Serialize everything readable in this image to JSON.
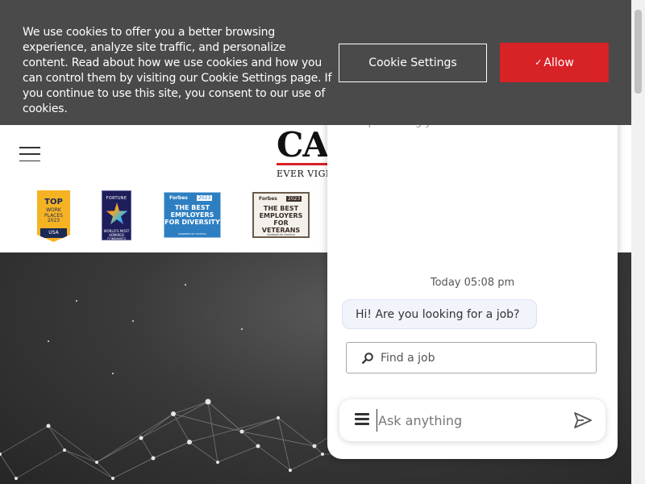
{
  "cookie_banner": {
    "text": "We use cookies to offer you a better browsing experience, analyze site traffic, and personalize content. Read about how we use cookies and how you can control them by visiting our Cookie Settings page. If you continue to use this site, you consent to our use of cookies.",
    "settings_label": "Cookie Settings",
    "allow_check": "✓",
    "allow_label": "Allow"
  },
  "header": {
    "logo_text": "CACI",
    "logo_tagline": "EVER VIGILANT",
    "badges": {
      "top_workplaces": {
        "line1": "TOP",
        "line2": "WORK PLACES",
        "year": "2023",
        "country": "USA"
      },
      "fortune": {
        "title": "FORTUNE",
        "line": "WORLD'S MOST ADMIRED COMPANIES"
      },
      "forbes_diversity": {
        "brand": "Forbes",
        "year": "2023",
        "line1": "THE BEST",
        "line2": "EMPLOYERS",
        "line3": "FOR DIVERSITY",
        "small": "POWERED BY STATISTA"
      },
      "forbes_veterans": {
        "brand": "Forbes",
        "year": "2023",
        "line1": "THE BEST",
        "line2": "EMPLOYERS",
        "line3": "FOR VETERANS",
        "small": "POWERED BY STATISTA"
      }
    }
  },
  "chat": {
    "faded_text": "and protecting your data",
    "timestamp": "Today 05:08 pm",
    "bot_message": "Hi! Are you looking for a job?",
    "find_job_label": "Find a job",
    "input_placeholder": "Ask anything"
  },
  "colors": {
    "banner_bg": "#4a4a4a",
    "allow_button": "#d72226",
    "hero_bg": "#3a3a3a"
  },
  "icons": [
    "hamburger-menu-icon",
    "search-icon",
    "chat-menu-icon",
    "send-icon",
    "check-icon"
  ]
}
